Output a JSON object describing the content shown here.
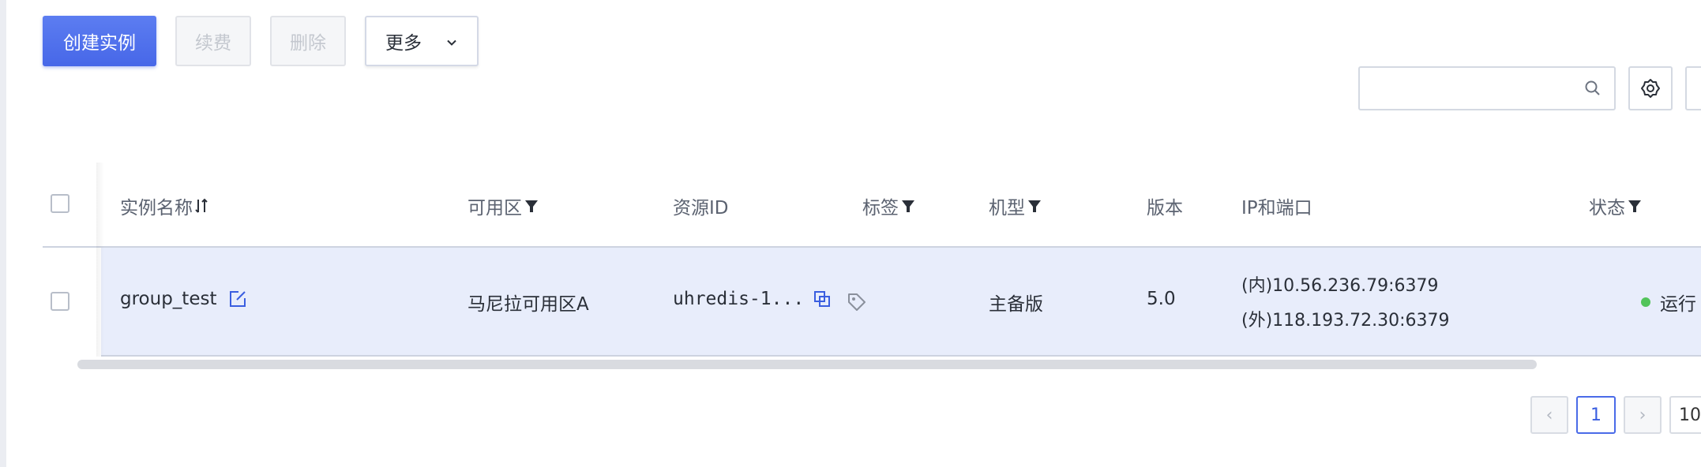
{
  "toolbar": {
    "create_label": "创建实例",
    "renew_label": "续费",
    "delete_label": "删除",
    "more_label": "更多"
  },
  "search": {
    "placeholder": ""
  },
  "table": {
    "columns": [
      "实例名称",
      "可用区",
      "资源ID",
      "标签",
      "机型",
      "版本",
      "IP和端口",
      "状态"
    ],
    "rows": [
      {
        "name": "group_test",
        "zone": "马尼拉可用区A",
        "resource_id": "uhredis-1...",
        "model": "主备版",
        "version": "5.0",
        "ip_internal": "(内)10.56.236.79:6379",
        "ip_external": "(外)118.193.72.30:6379",
        "status": "运行"
      }
    ]
  },
  "pagination": {
    "prev": "‹",
    "current_page": "1",
    "next": "›",
    "page_size_partial": "10"
  },
  "colors": {
    "primary": "#4a6be8",
    "row_selected": "#e8edfb",
    "status_running": "#52c45a"
  }
}
